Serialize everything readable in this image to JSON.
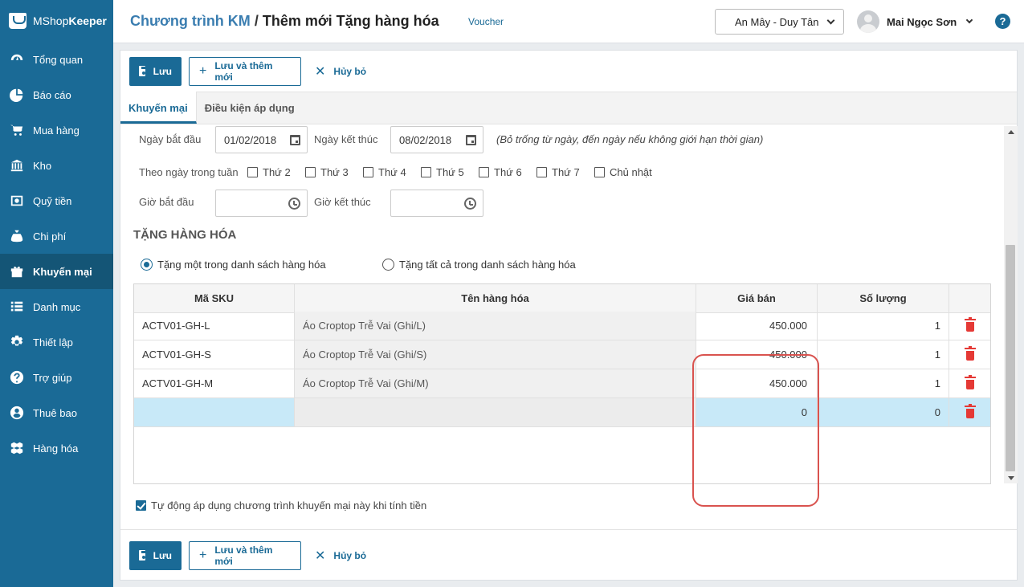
{
  "app": {
    "brand_light": "MShop",
    "brand_bold": "Keeper"
  },
  "sidebar": {
    "items": [
      {
        "label": "Tổng quan",
        "icon": "dashboard-icon"
      },
      {
        "label": "Báo cáo",
        "icon": "pie-chart-icon"
      },
      {
        "label": "Mua hàng",
        "icon": "cart-icon"
      },
      {
        "label": "Kho",
        "icon": "warehouse-icon"
      },
      {
        "label": "Quỹ tiền",
        "icon": "safe-icon"
      },
      {
        "label": "Chi phí",
        "icon": "money-bag-icon"
      },
      {
        "label": "Khuyến mại",
        "icon": "gift-icon",
        "active": true
      },
      {
        "label": "Danh mục",
        "icon": "list-icon"
      },
      {
        "label": "Thiết lập",
        "icon": "gear-icon"
      },
      {
        "label": "Trợ giúp",
        "icon": "help-icon"
      },
      {
        "label": "Thuê bao",
        "icon": "user-icon"
      },
      {
        "label": "Hàng hóa",
        "icon": "cubes-icon"
      }
    ]
  },
  "header": {
    "crumb_parent": "Chương trình KM",
    "crumb_sep": " / ",
    "crumb_current": "Thêm mới Tặng hàng hóa",
    "voucher_link": "Voucher",
    "store": "An Mây - Duy Tân",
    "user_name": "Mai Ngọc Sơn",
    "help": "?"
  },
  "toolbar": {
    "save": "Lưu",
    "save_new": "Lưu và thêm mới",
    "cancel": "Hủy bỏ"
  },
  "tabs": {
    "promo": "Khuyến mại",
    "conditions": "Điều kiện áp dụng"
  },
  "form": {
    "start_date_label": "Ngày bắt đầu",
    "start_date": "01/02/2018",
    "end_date_label": "Ngày kết thúc",
    "end_date": "08/02/2018",
    "date_hint": "(Bỏ trống từ ngày, đến ngày nếu không giới hạn thời gian)",
    "weekday_label": "Theo ngày trong tuần",
    "weekdays": [
      "Thứ 2",
      "Thứ 3",
      "Thứ 4",
      "Thứ 5",
      "Thứ 6",
      "Thứ 7",
      "Chủ nhật"
    ],
    "start_time_label": "Giờ bắt đầu",
    "end_time_label": "Giờ kết thúc",
    "section_title": "TẶNG HÀNG HÓA",
    "radio_one": "Tặng một trong danh sách hàng hóa",
    "radio_all": "Tặng tất cả trong danh sách hàng hóa",
    "auto_apply": "Tự động áp dụng chương trình khuyến mại này khi tính tiền"
  },
  "table": {
    "headers": {
      "sku": "Mã SKU",
      "name": "Tên hàng hóa",
      "price": "Giá bán",
      "qty": "Số lượng"
    },
    "rows": [
      {
        "sku": "ACTV01-GH-L",
        "name": "Áo Croptop Trễ Vai (Ghi/L)",
        "price": "450.000",
        "qty": "1"
      },
      {
        "sku": "ACTV01-GH-S",
        "name": "Áo Croptop Trễ Vai (Ghi/S)",
        "price": "450.000",
        "qty": "1"
      },
      {
        "sku": "ACTV01-GH-M",
        "name": "Áo Croptop Trễ Vai (Ghi/M)",
        "price": "450.000",
        "qty": "1"
      },
      {
        "sku": "",
        "name": "",
        "price": "0",
        "qty": "0"
      }
    ]
  },
  "colors": {
    "primary": "#1a6a96",
    "sidebar_active": "#145576",
    "new_row": "#c8e9f8",
    "danger": "#e53935",
    "highlight": "#d9534f"
  }
}
